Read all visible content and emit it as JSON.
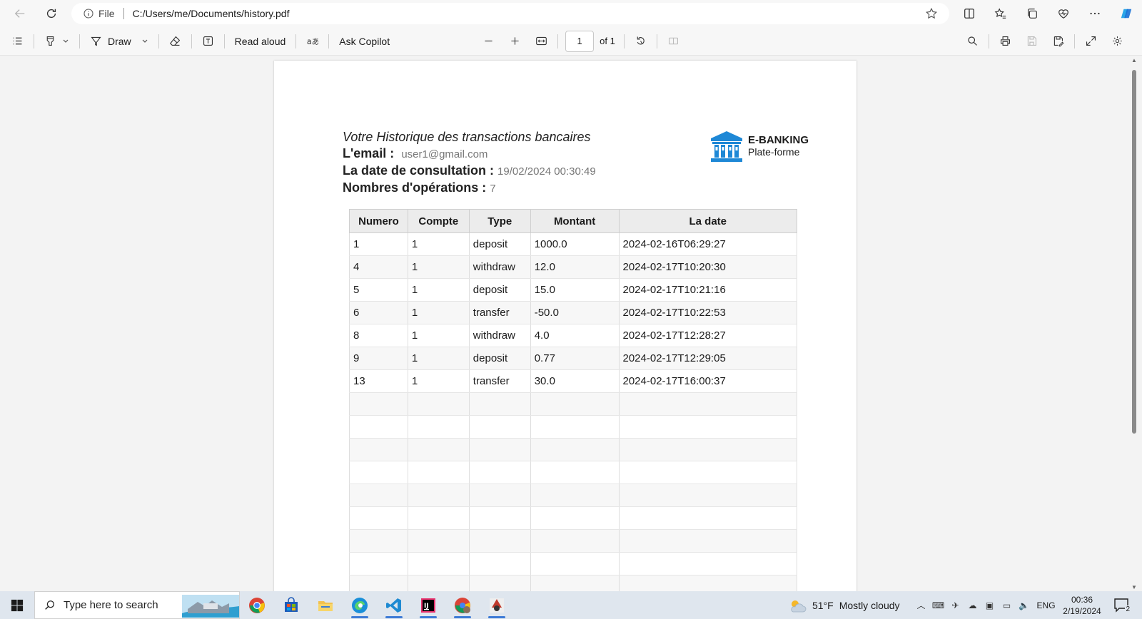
{
  "browser": {
    "address_label": "File",
    "url": "C:/Users/me/Documents/history.pdf"
  },
  "pdf_toolbar": {
    "draw_label": "Draw",
    "read_aloud_label": "Read aloud",
    "ask_copilot_label": "Ask Copilot",
    "page_current": "1",
    "page_total": "of 1"
  },
  "document": {
    "title": "Votre Historique des transactions bancaires",
    "email_label": "L'email :",
    "email_value": "user1@gmail.com",
    "date_label": "La date de consultation :",
    "date_value": "19/02/2024 00:30:49",
    "count_label": "Nombres d'opérations :",
    "count_value": "7",
    "brand_name": "E-BANKING",
    "brand_sub": "Plate-forme",
    "brand_color": "#1e88d6",
    "table": {
      "headers": [
        "Numero",
        "Compte",
        "Type",
        "Montant",
        "La date"
      ],
      "rows": [
        [
          "1",
          "1",
          "deposit",
          "1000.0",
          "2024-02-16T06:29:27"
        ],
        [
          "4",
          "1",
          "withdraw",
          "12.0",
          "2024-02-17T10:20:30"
        ],
        [
          "5",
          "1",
          "deposit",
          "15.0",
          "2024-02-17T10:21:16"
        ],
        [
          "6",
          "1",
          "transfer",
          "-50.0",
          "2024-02-17T10:22:53"
        ],
        [
          "8",
          "1",
          "withdraw",
          "4.0",
          "2024-02-17T12:28:27"
        ],
        [
          "9",
          "1",
          "deposit",
          "0.77",
          "2024-02-17T12:29:05"
        ],
        [
          "13",
          "1",
          "transfer",
          "30.0",
          "2024-02-17T16:00:37"
        ]
      ],
      "empty_rows": 9
    }
  },
  "taskbar": {
    "search_placeholder": "Type here to search",
    "weather_temp": "51°F",
    "weather_desc": "Mostly cloudy",
    "lang": "ENG",
    "time": "00:36",
    "date": "2/19/2024",
    "notif_count": "2"
  }
}
